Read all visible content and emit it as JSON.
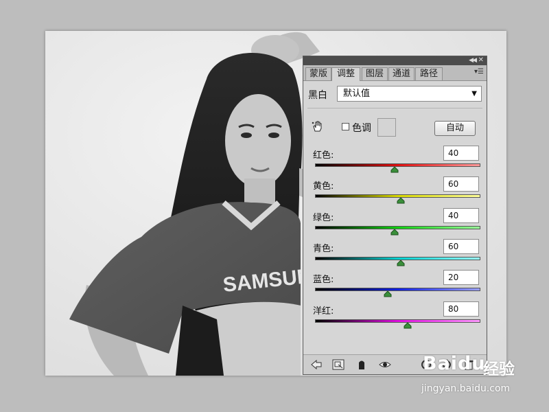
{
  "panel": {
    "tabs": [
      {
        "label": "蒙版",
        "active": false
      },
      {
        "label": "调整",
        "active": true
      },
      {
        "label": "图层",
        "active": false
      },
      {
        "label": "通道",
        "active": false
      },
      {
        "label": "路径",
        "active": false
      }
    ],
    "preset_label": "黑白",
    "preset_value": "默认值",
    "tint_label": "色调",
    "tint_checked": false,
    "auto_label": "自动",
    "sliders": [
      {
        "label": "红色:",
        "value": "40",
        "level": 0.48,
        "gradient": [
          "#000000",
          "#e01010",
          "#ff9a9a"
        ]
      },
      {
        "label": "黄色:",
        "value": "60",
        "level": 0.52,
        "gradient": [
          "#000000",
          "#d8d800",
          "#ffff9a"
        ]
      },
      {
        "label": "绿色:",
        "value": "40",
        "level": 0.48,
        "gradient": [
          "#000000",
          "#10d010",
          "#9aff9a"
        ]
      },
      {
        "label": "青色:",
        "value": "60",
        "level": 0.52,
        "gradient": [
          "#000000",
          "#00d0d0",
          "#9affff"
        ]
      },
      {
        "label": "蓝色:",
        "value": "20",
        "level": 0.44,
        "gradient": [
          "#000000",
          "#1020e0",
          "#9aa0ff"
        ]
      },
      {
        "label": "洋红:",
        "value": "80",
        "level": 0.56,
        "gradient": [
          "#000000",
          "#e010e0",
          "#ff9aff"
        ]
      }
    ],
    "thumb_color": "#3a8f3a"
  },
  "canvas": {
    "shirt_text": "SAMSUNG"
  },
  "watermark": {
    "brand": "Baidu",
    "cn": "经验",
    "url": "jingyan.baidu.com"
  }
}
